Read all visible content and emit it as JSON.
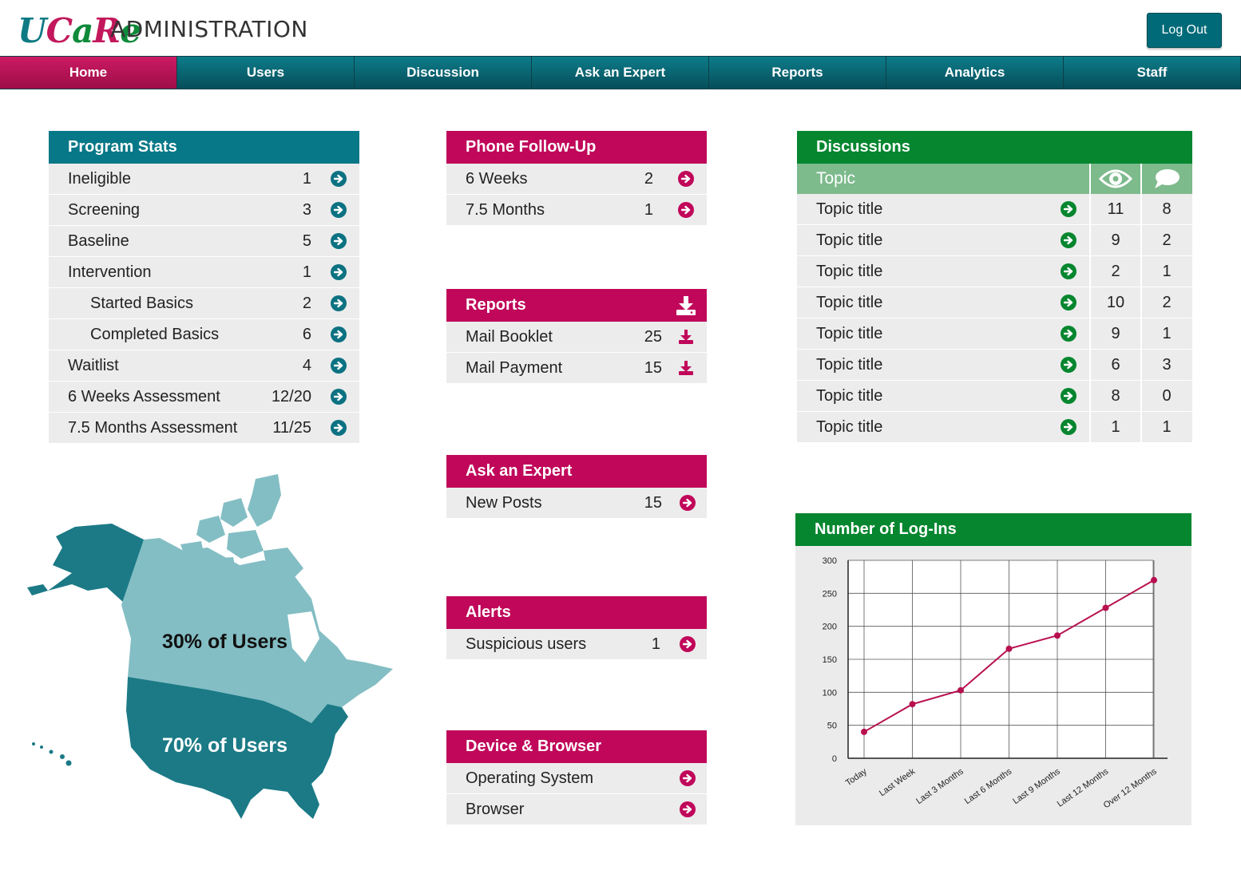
{
  "header": {
    "logo_text": "UCaRe",
    "title": "ADMINISTRATION",
    "logout_label": "Log Out"
  },
  "nav": {
    "tabs": [
      {
        "label": "Home",
        "active": true
      },
      {
        "label": "Users"
      },
      {
        "label": "Discussion"
      },
      {
        "label": "Ask an Expert"
      },
      {
        "label": "Reports"
      },
      {
        "label": "Analytics"
      },
      {
        "label": "Staff"
      }
    ]
  },
  "program_stats": {
    "title": "Program Stats",
    "rows": [
      {
        "label": "Ineligible",
        "value": "1"
      },
      {
        "label": "Screening",
        "value": "3"
      },
      {
        "label": "Baseline",
        "value": "5"
      },
      {
        "label": "Intervention",
        "value": "1"
      },
      {
        "label": "Started Basics",
        "value": "2",
        "indent": true
      },
      {
        "label": "Completed Basics",
        "value": "6",
        "indent": true
      },
      {
        "label": "Waitlist",
        "value": "4"
      },
      {
        "label": "6 Weeks Assessment",
        "value": "12/20"
      },
      {
        "label": "7.5 Months Assessment",
        "value": "11/25"
      }
    ]
  },
  "phone_followup": {
    "title": "Phone Follow-Up",
    "rows": [
      {
        "label": "6 Weeks",
        "value": "2"
      },
      {
        "label": "7.5 Months",
        "value": "1"
      }
    ]
  },
  "reports": {
    "title": "Reports",
    "rows": [
      {
        "label": "Mail Booklet",
        "value": "25"
      },
      {
        "label": "Mail Payment",
        "value": "15"
      }
    ]
  },
  "ask_expert": {
    "title": "Ask an Expert",
    "rows": [
      {
        "label": "New Posts",
        "value": "15"
      }
    ]
  },
  "alerts": {
    "title": "Alerts",
    "rows": [
      {
        "label": "Suspicious users",
        "value": "1"
      }
    ]
  },
  "device_browser": {
    "title": "Device & Browser",
    "rows": [
      {
        "label": "Operating System"
      },
      {
        "label": "Browser"
      }
    ]
  },
  "discussions": {
    "title": "Discussions",
    "topic_header": "Topic",
    "views_icon": "eye-icon",
    "comments_icon": "speech-bubble-icon",
    "rows": [
      {
        "title": "Topic title",
        "views": "11",
        "comments": "8"
      },
      {
        "title": "Topic title",
        "views": "9",
        "comments": "2"
      },
      {
        "title": "Topic title",
        "views": "2",
        "comments": "1"
      },
      {
        "title": "Topic title",
        "views": "10",
        "comments": "2"
      },
      {
        "title": "Topic title",
        "views": "9",
        "comments": "1"
      },
      {
        "title": "Topic title",
        "views": "6",
        "comments": "3"
      },
      {
        "title": "Topic title",
        "views": "8",
        "comments": "0"
      },
      {
        "title": "Topic title",
        "views": "1",
        "comments": "1"
      }
    ]
  },
  "map": {
    "canada_label": "30% of Users",
    "usa_label": "70% of Users",
    "colors": {
      "canada": "#83bec4",
      "usa": "#1b7a86"
    }
  },
  "colors": {
    "teal": "#067888",
    "magenta": "#c0075a",
    "green": "#05862f"
  },
  "chart_data": {
    "type": "line",
    "title": "Number of Log-Ins",
    "categories": [
      "Today",
      "Last Week",
      "Last 3 Months",
      "Last 6 Months",
      "Last 9 Months",
      "Last 12 Months",
      "Over 12 Months"
    ],
    "values": [
      40,
      82,
      103,
      166,
      186,
      228,
      270
    ],
    "ylim": [
      0,
      300
    ],
    "yticks": [
      0,
      50,
      100,
      150,
      200,
      250,
      300
    ],
    "grid": true,
    "line_color": "#b8104f"
  }
}
